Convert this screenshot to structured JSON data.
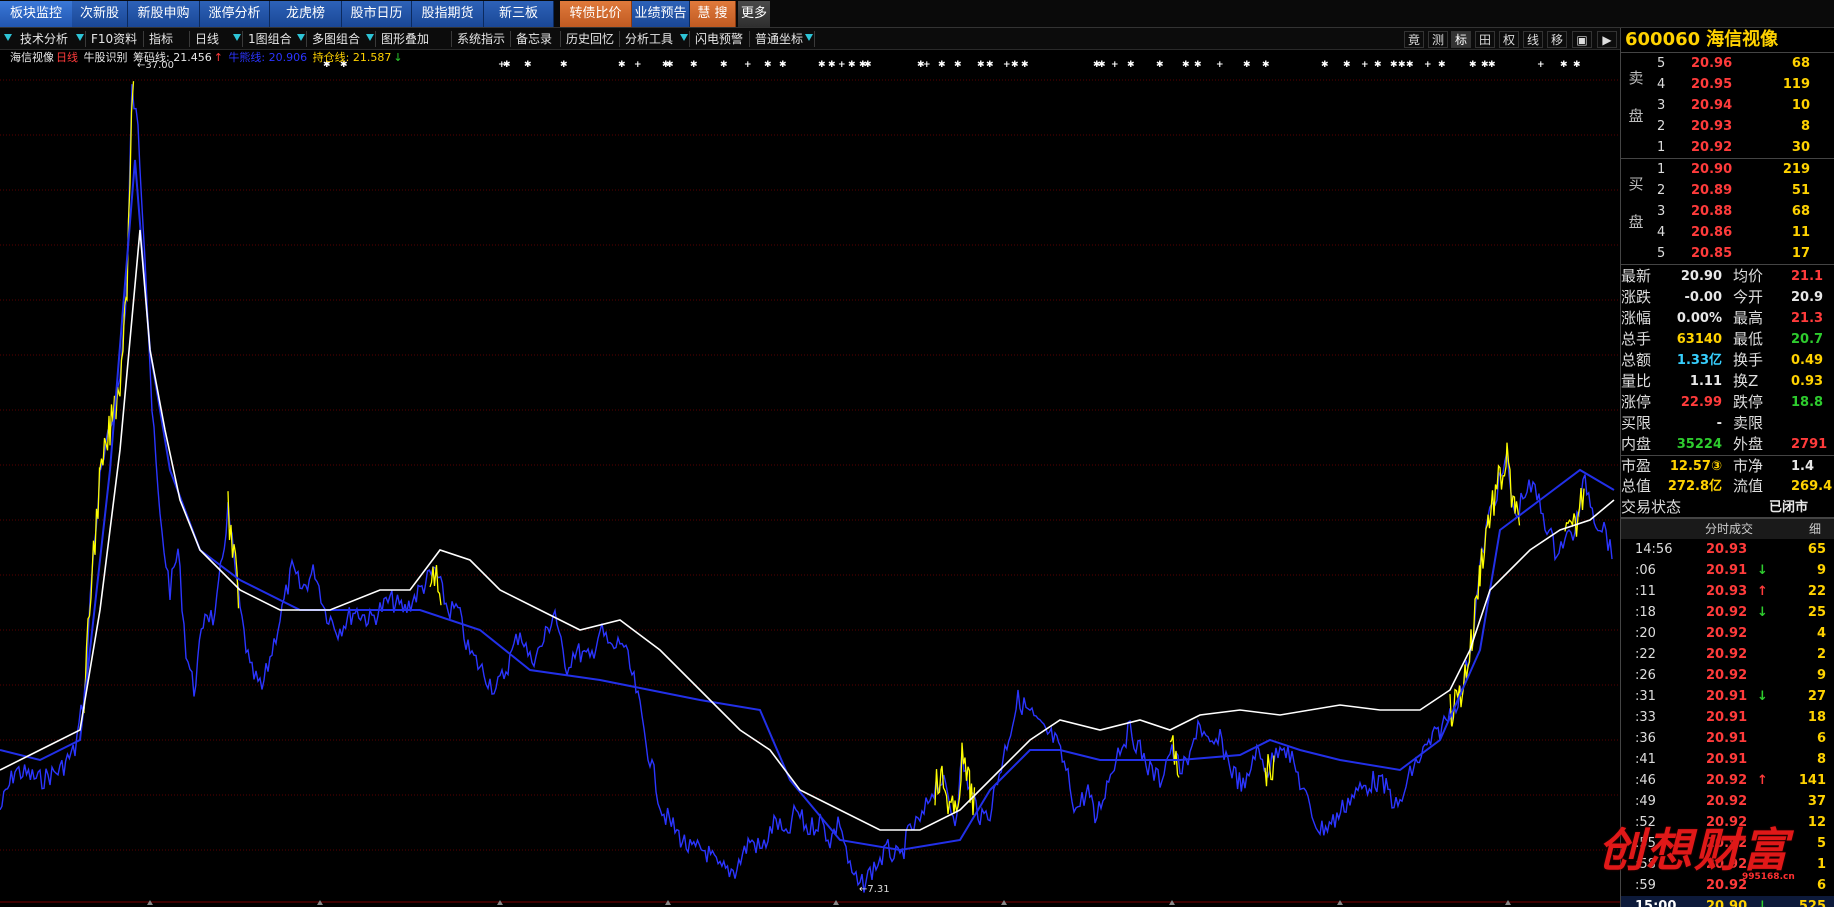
{
  "top_nav": {
    "tabs": [
      {
        "label": "板块监控",
        "style": "active"
      },
      {
        "label": "次新股",
        "style": "blue"
      },
      {
        "label": "新股申购",
        "style": "blue"
      },
      {
        "label": "涨停分析",
        "style": "blue"
      },
      {
        "label": "龙虎榜",
        "style": "blue"
      },
      {
        "label": "股市日历",
        "style": "blue"
      },
      {
        "label": "股指期货",
        "style": "blue"
      },
      {
        "label": "新三板",
        "style": "blue"
      },
      {
        "label": "转债比价",
        "style": "orange"
      },
      {
        "label": "业绩预告",
        "style": "blue"
      },
      {
        "label": "慧 搜",
        "style": "orange"
      },
      {
        "label": "更多",
        "style": "gray"
      }
    ]
  },
  "toolbar": {
    "items": [
      "技术分析",
      "F10资料",
      "指标",
      "日线",
      "1图组合",
      "多图组合",
      "图形叠加",
      "系统指示",
      "备忘录",
      "历史回忆",
      "分析工具",
      "闪电预警",
      "普通坐标"
    ],
    "right_buttons": [
      "竟",
      "测",
      "标",
      "田",
      "权",
      "线",
      "移",
      "▣",
      "▶"
    ]
  },
  "legend": {
    "stock_name": "海信视像",
    "period": "日线",
    "indicator": "牛股识别",
    "line1_label": "筹码线: 21.456",
    "line1_arrow": "↑",
    "line2_label": "牛熊线: 20.906",
    "line3_label": "持仓线: 21.587",
    "line3_arrow": "↓"
  },
  "price_labels": {
    "high": "←37.00",
    "low": "←7.31"
  },
  "panel": {
    "code": "600060",
    "name": "海信视像",
    "sell_label": [
      "卖",
      "盘"
    ],
    "buy_label": [
      "买",
      "盘"
    ],
    "asks": [
      {
        "level": "5",
        "price": "20.96",
        "vol": "68"
      },
      {
        "level": "4",
        "price": "20.95",
        "vol": "119"
      },
      {
        "level": "3",
        "price": "20.94",
        "vol": "10"
      },
      {
        "level": "2",
        "price": "20.93",
        "vol": "8"
      },
      {
        "level": "1",
        "price": "20.92",
        "vol": "30"
      }
    ],
    "bids": [
      {
        "level": "1",
        "price": "20.90",
        "vol": "219"
      },
      {
        "level": "2",
        "price": "20.89",
        "vol": "51"
      },
      {
        "level": "3",
        "price": "20.88",
        "vol": "68"
      },
      {
        "level": "4",
        "price": "20.86",
        "vol": "11"
      },
      {
        "level": "5",
        "price": "20.85",
        "vol": "17"
      }
    ],
    "quote": [
      {
        "k1": "最新",
        "v1": "20.90",
        "c1": "wht",
        "k2": "均价",
        "v2": "21.1",
        "c2": "red"
      },
      {
        "k1": "涨跌",
        "v1": "-0.00",
        "c1": "wht",
        "k2": "今开",
        "v2": "20.9",
        "c2": "wht"
      },
      {
        "k1": "涨幅",
        "v1": "0.00%",
        "c1": "wht",
        "k2": "最高",
        "v2": "21.3",
        "c2": "red"
      },
      {
        "k1": "总手",
        "v1": "63140",
        "c1": "yel",
        "k2": "最低",
        "v2": "20.7",
        "c2": "grn"
      },
      {
        "k1": "总额",
        "v1": "1.33亿",
        "c1": "cyan",
        "k2": "换手",
        "v2": "0.49",
        "c2": "yel"
      },
      {
        "k1": "量比",
        "v1": "1.11",
        "c1": "wht",
        "k2": "换Z",
        "v2": "0.93",
        "c2": "yel"
      },
      {
        "k1": "涨停",
        "v1": "22.99",
        "c1": "red",
        "k2": "跌停",
        "v2": "18.8",
        "c2": "grn"
      },
      {
        "k1": "买限",
        "v1": "-",
        "c1": "wht",
        "k2": "卖限",
        "v2": "",
        "c2": "wht"
      },
      {
        "k1": "内盘",
        "v1": "35224",
        "c1": "grn",
        "k2": "外盘",
        "v2": "2791",
        "c2": "red"
      },
      {
        "k1": "市盈",
        "v1": "12.57③",
        "c1": "yel",
        "k2": "市净",
        "v2": "1.4",
        "c2": "wht"
      },
      {
        "k1": "总值",
        "v1": "272.8亿",
        "c1": "yel",
        "k2": "流值",
        "v2": "269.4",
        "c2": "yel"
      },
      {
        "k1": "交易状态",
        "v1": "",
        "c1": "wht",
        "k2": "",
        "v2": "已闭市",
        "c2": "wht"
      }
    ],
    "trades_header": {
      "title": "分时成交",
      "more": "细"
    },
    "trades": [
      {
        "time": "14:56",
        "price": "20.93",
        "arrow": "",
        "vol": "65"
      },
      {
        "time": ":06",
        "price": "20.91",
        "arrow": "↓",
        "vol": "9"
      },
      {
        "time": ":11",
        "price": "20.93",
        "arrow": "↑",
        "vol": "22"
      },
      {
        "time": ":18",
        "price": "20.92",
        "arrow": "↓",
        "vol": "25"
      },
      {
        "time": ":20",
        "price": "20.92",
        "arrow": "",
        "vol": "4"
      },
      {
        "time": ":22",
        "price": "20.92",
        "arrow": "",
        "vol": "2"
      },
      {
        "time": ":26",
        "price": "20.92",
        "arrow": "",
        "vol": "9"
      },
      {
        "time": ":31",
        "price": "20.91",
        "arrow": "↓",
        "vol": "27"
      },
      {
        "time": ":33",
        "price": "20.91",
        "arrow": "",
        "vol": "18"
      },
      {
        "time": ":36",
        "price": "20.91",
        "arrow": "",
        "vol": "6"
      },
      {
        "time": ":41",
        "price": "20.91",
        "arrow": "",
        "vol": "8"
      },
      {
        "time": ":46",
        "price": "20.92",
        "arrow": "↑",
        "vol": "141"
      },
      {
        "time": ":49",
        "price": "20.92",
        "arrow": "",
        "vol": "37"
      },
      {
        "time": ":52",
        "price": "20.92",
        "arrow": "",
        "vol": "12"
      },
      {
        "time": ":55",
        "price": "20.92",
        "arrow": "",
        "vol": "5"
      },
      {
        "time": ":58",
        "price": "20.92",
        "arrow": "",
        "vol": "1"
      },
      {
        "time": ":59",
        "price": "20.92",
        "arrow": "",
        "vol": "6"
      },
      {
        "time": "15:00",
        "price": "20.90",
        "arrow": "↓",
        "vol": "525"
      }
    ]
  },
  "watermark": {
    "text": "创想财富",
    "url": "995168.cn"
  },
  "colors": {
    "price_line": "#2b35ff",
    "hot_segments": "#ffff00",
    "white_line": "#ffffff",
    "grid": "#5a0000"
  }
}
